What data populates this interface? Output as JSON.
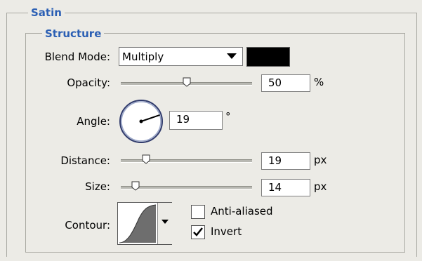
{
  "satin": {
    "legend": "Satin"
  },
  "structure": {
    "legend": "Structure",
    "blend_mode": {
      "label": "Blend Mode:",
      "value": "Multiply",
      "color": "#000000"
    },
    "opacity": {
      "label": "Opacity:",
      "value": "50",
      "unit": "%",
      "slider_fraction": 0.5
    },
    "angle": {
      "label": "Angle:",
      "value": "19",
      "unit": "°",
      "degrees": 19
    },
    "distance": {
      "label": "Distance:",
      "value": "19",
      "unit": "px",
      "slider_fraction": 0.19
    },
    "size": {
      "label": "Size:",
      "value": "14",
      "unit": "px",
      "slider_fraction": 0.11
    },
    "contour": {
      "label": "Contour:"
    },
    "anti_aliased": {
      "label": "Anti-aliased",
      "checked": false
    },
    "invert": {
      "label": "Invert",
      "checked": true
    }
  }
}
